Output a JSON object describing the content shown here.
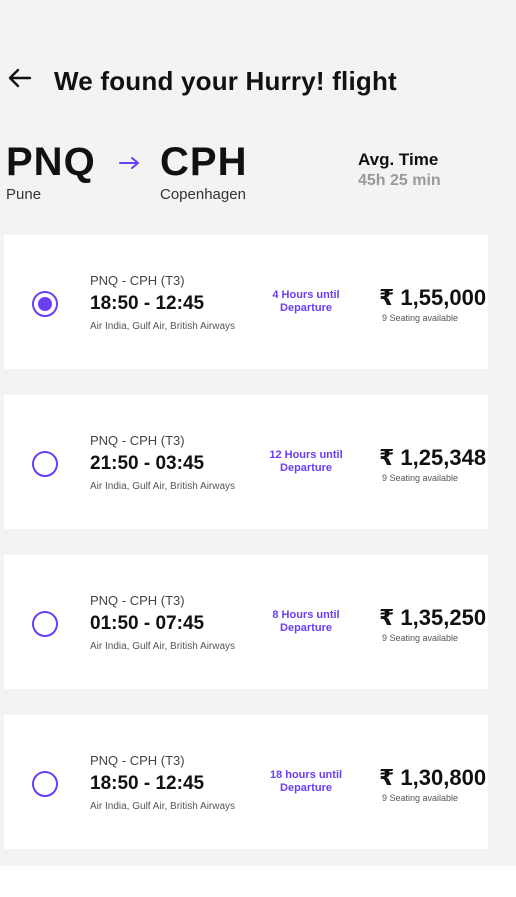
{
  "header": {
    "title": "We found your Hurry! flight"
  },
  "route": {
    "from_code": "PNQ",
    "from_city": "Pune",
    "to_code": "CPH",
    "to_city": "Copenhagen",
    "avg_label": "Avg. Time",
    "avg_value": "45h 25 min"
  },
  "colors": {
    "accent": "#6a3df6",
    "background": "#f3f3f3"
  },
  "flights": [
    {
      "selected": true,
      "route": "PNQ - CPH (T3)",
      "time": "18:50 - 12:45",
      "airlines": "Air India, Gulf Air, British Airways",
      "departure": "4 Hours until Departure",
      "price": "₹ 1,55,000",
      "seats": "9 Seating available"
    },
    {
      "selected": false,
      "route": "PNQ - CPH (T3)",
      "time": "21:50 - 03:45",
      "airlines": "Air India, Gulf Air, British Airways",
      "departure": "12 Hours until Departure",
      "price": "₹ 1,25,348",
      "seats": "9 Seating available"
    },
    {
      "selected": false,
      "route": "PNQ - CPH (T3)",
      "time": "01:50 - 07:45",
      "airlines": "Air India, Gulf Air, British Airways",
      "departure": "8 Hours until Departure",
      "price": "₹ 1,35,250",
      "seats": "9 Seating available"
    },
    {
      "selected": false,
      "route": "PNQ - CPH (T3)",
      "time": "18:50 - 12:45",
      "airlines": "Air India, Gulf Air, British Airways",
      "departure": "18 hours until Departure",
      "price": "₹ 1,30,800",
      "seats": "9 Seating available"
    }
  ]
}
